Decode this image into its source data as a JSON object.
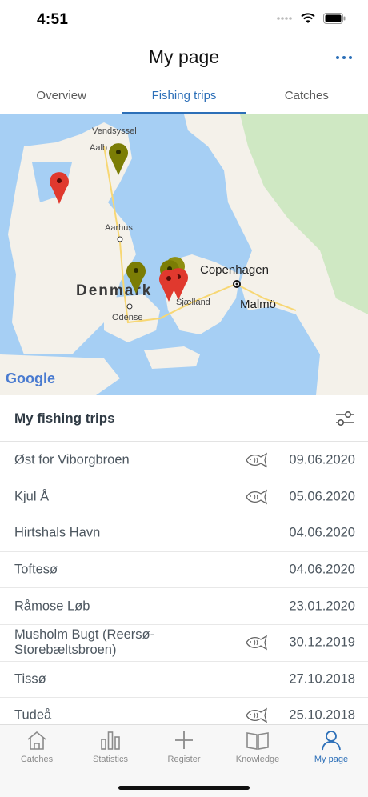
{
  "status": {
    "time": "4:51"
  },
  "header": {
    "title": "My page"
  },
  "tabs": [
    {
      "label": "Overview",
      "active": false
    },
    {
      "label": "Fishing trips",
      "active": true
    },
    {
      "label": "Catches",
      "active": false
    }
  ],
  "map": {
    "labels": {
      "vendsyssel": "Vendsyssel",
      "aalborg": "Aalb",
      "aarhus": "Aarhus",
      "denmark": "Denmark",
      "odense": "Odense",
      "copenhagen": "Copenhagen",
      "sjaelland": "Sjælland",
      "malmo": "Malmö",
      "google": "Google"
    },
    "colors": {
      "water": "#a6cff4",
      "land": "#f4f1ea",
      "green_area": "#cfe8c3",
      "pin_red": "#e0392e",
      "pin_olive": "#7b7d05"
    }
  },
  "trips": {
    "title": "My fishing trips",
    "filter_icon": "sliders-icon",
    "items": [
      {
        "name": "Øst for Viborgbroen",
        "date": "09.06.2020",
        "has_catch": true
      },
      {
        "name": "Kjul Å",
        "date": "05.06.2020",
        "has_catch": true
      },
      {
        "name": "Hirtshals Havn",
        "date": "04.06.2020",
        "has_catch": false
      },
      {
        "name": "Toftesø",
        "date": "04.06.2020",
        "has_catch": false
      },
      {
        "name": "Råmose Løb",
        "date": "23.01.2020",
        "has_catch": false
      },
      {
        "name": "Musholm Bugt (Reersø-Storebæltsbroen)",
        "date": "30.12.2019",
        "has_catch": true
      },
      {
        "name": "Tissø",
        "date": "27.10.2018",
        "has_catch": false
      },
      {
        "name": "Tudeå",
        "date": "25.10.2018",
        "has_catch": true
      }
    ]
  },
  "tabbar": {
    "items": [
      {
        "label": "Catches",
        "icon": "home-icon",
        "active": false
      },
      {
        "label": "Statistics",
        "icon": "bar-chart-icon",
        "active": false
      },
      {
        "label": "Register",
        "icon": "plus-icon",
        "active": false
      },
      {
        "label": "Knowledge",
        "icon": "book-icon",
        "active": false
      },
      {
        "label": "My page",
        "icon": "user-icon",
        "active": true
      }
    ],
    "accent": "#2c6fb8"
  }
}
